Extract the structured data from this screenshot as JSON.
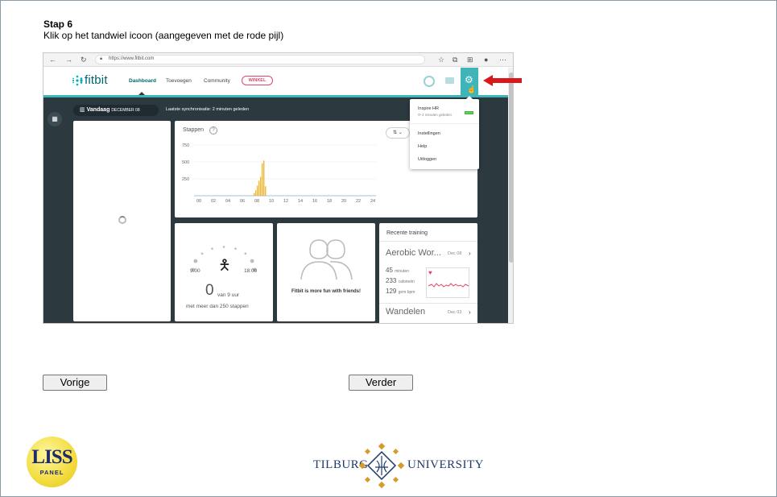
{
  "instruction": {
    "title": "Stap 6",
    "text": "Klik op het tandwiel icoon (aangegeven met de rode pijl)"
  },
  "browser": {
    "url": "https://www.fitbit.com"
  },
  "fitbit": {
    "logo": "fitbit",
    "nav": {
      "dashboard": "Dashboard",
      "add": "Toevoegen",
      "community": "Community",
      "shop": "WINKEL"
    },
    "date_label": "Vandaag",
    "date_value": "DECEMBER 08",
    "sync_text": "Laatste synchronisatie: 2 minuten geleden",
    "steps_title": "Stappen",
    "steps_help": "?",
    "y_ticks": [
      "750",
      "500",
      "250"
    ],
    "x_ticks": [
      "00",
      "02",
      "04",
      "06",
      "08",
      "10",
      "12",
      "14",
      "16",
      "18",
      "20",
      "22",
      "24"
    ],
    "hourly": {
      "time_start": "9.00",
      "time_end": "18:00",
      "value": "0",
      "unit": "van 9 uur",
      "note": "met meer dan 250 stappen"
    },
    "friends_text": "Fitbit is more fun with friends!",
    "recent": {
      "title": "Recente training",
      "aerobic": "Aerobic Wor...",
      "aerobic_date": "Dec 08",
      "minutes": "45",
      "minutes_unit": "minuten",
      "calories": "233",
      "calories_unit": "calorieën",
      "bpm": "129",
      "bpm_unit": "gem bpm",
      "walking": "Wandelen",
      "walking_date": "Dec 03"
    },
    "dropdown": {
      "device": "Inspire HR",
      "device_sync": "4 minuten geleden",
      "settings": "Instellingen",
      "help": "Help",
      "logout": "Uitloggen"
    }
  },
  "buttons": {
    "prev": "Vorige",
    "next": "Verder"
  },
  "logos": {
    "liss": "LISS",
    "liss_sub": "PANEL",
    "tilburg": "TILBURG",
    "university": "UNIVERSITY"
  },
  "chart_data": {
    "type": "bar",
    "title": "Stappen",
    "x": [
      "07:00",
      "07:15",
      "07:30",
      "07:45",
      "08:00",
      "08:15",
      "08:30",
      "08:45"
    ],
    "values": [
      40,
      80,
      150,
      220,
      280,
      480,
      520,
      140
    ],
    "ylim": [
      0,
      750
    ],
    "y_ticks": [
      250,
      500,
      750
    ],
    "color": "#f2b632"
  },
  "colors": {
    "accent": "#3fb5b9",
    "dark": "#2c3a40",
    "arrow": "#d7191c"
  }
}
